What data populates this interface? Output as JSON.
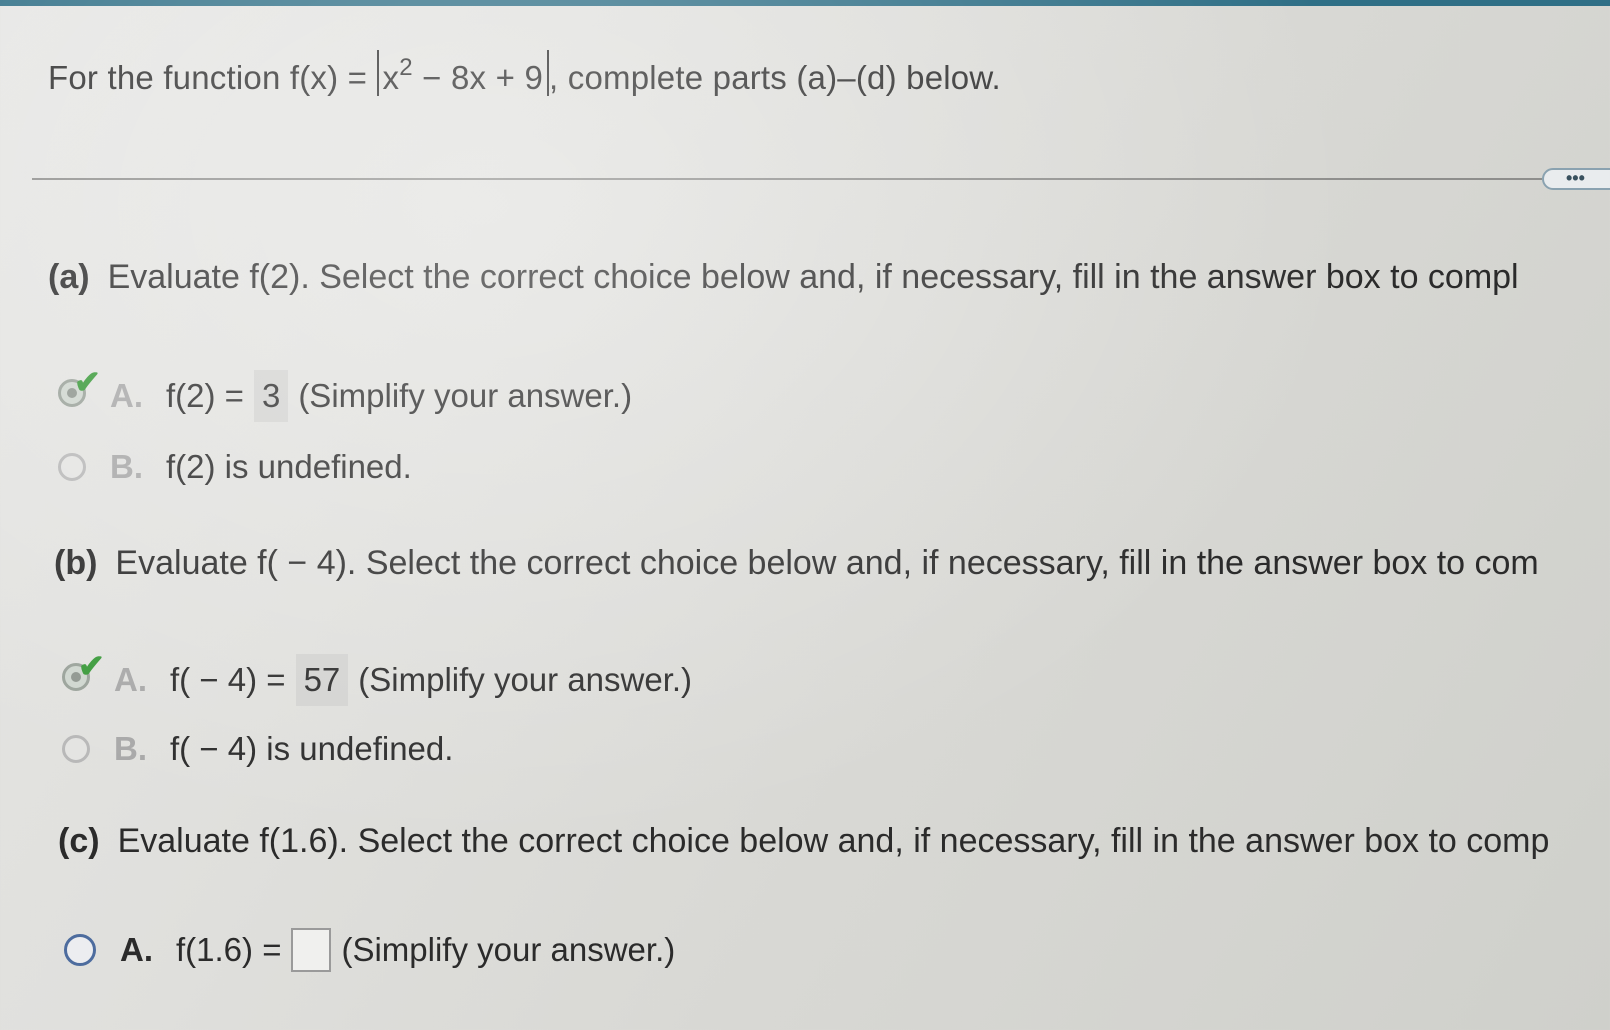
{
  "problem": {
    "lead": "For the function f(x) = ",
    "abs_base": "x",
    "abs_exp": "2",
    "abs_rest": " − 8x + 9",
    "tail": ", complete parts (a)–(d) below."
  },
  "more_button": {
    "label": "•••"
  },
  "parts": {
    "a": {
      "label": "(a)",
      "prompt": "Evaluate f(2). Select the correct choice below and, if necessary, fill in the answer box to compl",
      "choice_a": {
        "letter": "A.",
        "prefix": "f(2) =",
        "value": "3",
        "suffix": "(Simplify your answer.)"
      },
      "choice_b": {
        "letter": "B.",
        "text": "f(2) is undefined."
      }
    },
    "b": {
      "label": "(b)",
      "prompt": "Evaluate f( − 4). Select the correct choice below and, if necessary, fill in the answer box to com",
      "choice_a": {
        "letter": "A.",
        "prefix": "f( − 4) =",
        "value": "57",
        "suffix": "(Simplify your answer.)"
      },
      "choice_b": {
        "letter": "B.",
        "text": "f( − 4) is undefined."
      }
    },
    "c": {
      "label": "(c)",
      "prompt": "Evaluate f(1.6). Select the correct choice below and, if necessary, fill in the answer box to comp",
      "choice_a": {
        "letter": "A.",
        "prefix": "f(1.6) =",
        "value": "",
        "suffix": "(Simplify your answer.)"
      }
    }
  }
}
